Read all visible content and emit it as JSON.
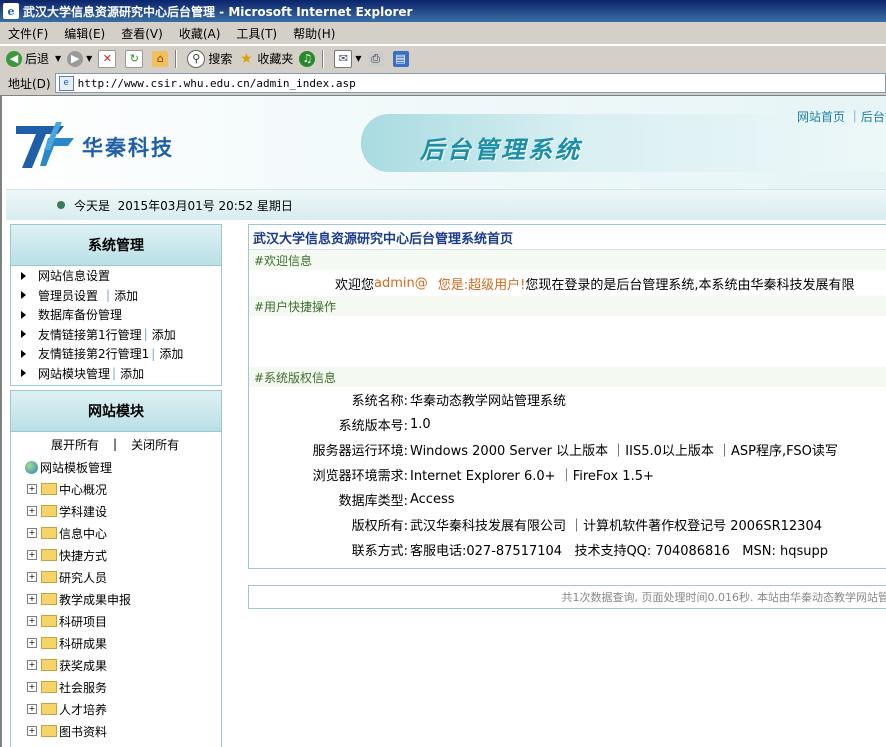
{
  "window": {
    "title": "武汉大学信息资源研究中心后台管理 - Microsoft Internet Explorer"
  },
  "menubar": [
    "文件(F)",
    "编辑(E)",
    "查看(V)",
    "收藏(A)",
    "工具(T)",
    "帮助(H)"
  ],
  "toolbar": {
    "back": "后退",
    "search": "搜索",
    "favorites": "收藏夹"
  },
  "addressbar": {
    "label": "地址(D)",
    "url": "http://www.csir.whu.edu.cn/admin_index.asp"
  },
  "header": {
    "logo_text": "华秦科技",
    "banner_text": "后台管理系统",
    "toplinks": "网站首页 ｜后台管"
  },
  "datebar": {
    "text": "今天是  2015年03月01号 20:52 星期日"
  },
  "sidebar": {
    "sys_title": "系统管理",
    "sys_items": [
      {
        "label": "网站信息设置",
        "extra": ""
      },
      {
        "label": "管理员设置",
        "extra": "添加"
      },
      {
        "label": "数据库备份管理",
        "extra": ""
      },
      {
        "label": "友情链接第1行管理",
        "extra": "添加"
      },
      {
        "label": "友情链接第2行管理1",
        "extra": "添加"
      },
      {
        "label": "网站模块管理",
        "extra": "添加"
      }
    ],
    "mod_title": "网站模块",
    "expand_all": "展开所有",
    "divider": "|",
    "collapse_all": "关闭所有",
    "root": "网站模板管理",
    "tree": [
      "中心概况",
      "学科建设",
      "信息中心",
      "快捷方式",
      "研究人员",
      "教学成果申报",
      "科研项目",
      "科研成果",
      "获奖成果",
      "社会服务",
      "人才培养",
      "图书资料"
    ]
  },
  "main": {
    "title": "武汉大学信息资源研究中心后台管理系统首页",
    "welcome_head": "#欢迎信息",
    "welcome_prefix": "欢迎您",
    "welcome_user": "admin@",
    "welcome_role": "您是:超级用户!",
    "welcome_rest": "您现在登录的是后台管理系统,本系统由华秦科技发展有限",
    "shortcut_head": "#用户快捷操作",
    "copyright_head": "#系统版权信息",
    "info": [
      {
        "label": "系统名称:",
        "value": "华秦动态教学网站管理系统"
      },
      {
        "label": "系统版本号:",
        "value": "1.0"
      },
      {
        "label": "服务器运行环境:",
        "value": "Windows 2000 Server 以上版本 ｜IIS5.0以上版本 ｜ASP程序,FSO读写"
      },
      {
        "label": "浏览器环境需求:",
        "value": "Internet Explorer 6.0+ ｜FireFox 1.5+"
      },
      {
        "label": "数据库类型:",
        "value": "Access"
      },
      {
        "label": "版权所有:",
        "value": "武汉华秦科技发展有限公司 ｜计算机软件著作权登记号 2006SR12304"
      },
      {
        "label": "联系方式:",
        "value": "客服电话:027-87517104   技术支持QQ: 704086816   MSN: hqsupp"
      }
    ],
    "footer": "共1次数据查询, 页面处理时间0.016秒. 本站由华秦动态教学网站管"
  }
}
